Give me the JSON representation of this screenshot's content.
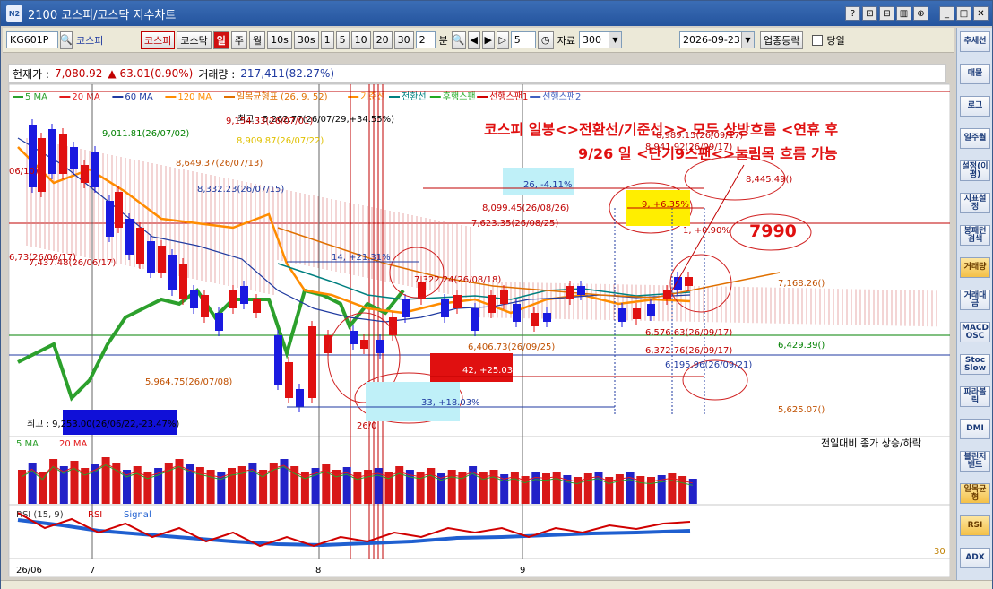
{
  "window": {
    "badge": "N2",
    "title": "2100 코스피/코스닥 지수차트",
    "buttons": [
      "?",
      "⊡",
      "⊟",
      "▥",
      "⊕",
      "_",
      "□",
      "✕"
    ]
  },
  "toolbar": {
    "code": "KG601P",
    "name": "코스피",
    "btn_kospi": "코스피",
    "btn_kosdaq": "코스닥",
    "btn_day": "일",
    "btn_week": "주",
    "btn_month": "월",
    "btn_10s": "10s",
    "btn_30s": "30s",
    "periods": [
      "1",
      "5",
      "10",
      "20",
      "30"
    ],
    "min_value": "2",
    "min_label": "분",
    "step_value": "5",
    "data_label": "자료",
    "data_value": "300",
    "date_value": "2026-09-23",
    "sector_button": "업종등락",
    "today_label": "당일"
  },
  "info": {
    "price_label": "현재가 :",
    "price": "7,080.92",
    "change": "▲ 63.01(0.90%)",
    "volume_label": "거래량 :",
    "volume": "217,411(82.27%)"
  },
  "legend": [
    {
      "text": "5 MA",
      "color": "#2ca02c"
    },
    {
      "text": "20 MA",
      "color": "#e31a1c"
    },
    {
      "text": "60 MA",
      "color": "#1f3aa0"
    },
    {
      "text": "120 MA",
      "color": "#ff8c00"
    },
    {
      "text": "일목균형표 (26, 9, 52)",
      "color": "#e07000"
    },
    {
      "text": "기준선",
      "color": "#ff8c00"
    },
    {
      "text": "전환선",
      "color": "#008080"
    },
    {
      "text": "후행스팬",
      "color": "#22aa22"
    },
    {
      "text": "선행스팬1",
      "color": "#d00000"
    },
    {
      "text": "선행스팬2",
      "color": "#4060c0"
    }
  ],
  "annotations": {
    "comment_line1": "코스피 일봉<>전환선/기준선>> 모두 상방흐름 <연휴 후",
    "comment_line2": "9/26 일 <단기9스팬<>눌림목 흐름 가능",
    "target": "7990",
    "high": "최고 : 5,262.77(26/07/29,+34.55%)",
    "low": "최고 : 9,253.00(26/06/22,-23.47%)",
    "labels": [
      {
        "text": "9,011.81(26/07/02)",
        "color": "#008000"
      },
      {
        "text": "9,154.33(26/07/01)",
        "color": "#c00000"
      },
      {
        "text": "8,909.87(26/07/22)",
        "color": "#e0c000"
      },
      {
        "text": "8,649.37(26/07/13)",
        "color": "#c05000"
      },
      {
        "text": "8,332.23(26/07/15)",
        "color": "#1f3aa0"
      },
      {
        "text": "8,099.45(26/08/26)",
        "color": "#c00000"
      },
      {
        "text": "8,989.15(26/09/17)",
        "color": "#c00000"
      },
      {
        "text": "8,941.92(26/09/17)",
        "color": "#c00000"
      },
      {
        "text": "8,445.49()",
        "color": "#c00000"
      },
      {
        "text": "7,623.35(26/08/25)",
        "color": "#c00000"
      },
      {
        "text": "7,322.24(26/08/18)",
        "color": "#c00000"
      },
      {
        "text": "7,168.26()",
        "color": "#c05000"
      },
      {
        "text": "6,576.63(26/09/17)",
        "color": "#c00000"
      },
      {
        "text": "6,406.73(26/09/25)",
        "color": "#c05000"
      },
      {
        "text": "6,372.76(26/09/17)",
        "color": "#c00000"
      },
      {
        "text": "6,429.39()",
        "color": "#008000"
      },
      {
        "text": "6,195.96(26/09/21)",
        "color": "#1f3aa0"
      },
      {
        "text": "5,964.75(26/07/08)",
        "color": "#c05000"
      },
      {
        "text": "5,625.07()",
        "color": "#c05000"
      },
      {
        "text": "6,73(26/06/17)",
        "color": "#c00000"
      },
      {
        "text": "7,437.48(26/06/17)",
        "color": "#c00000"
      },
      {
        "text": "06/10)",
        "color": "#c00000"
      },
      {
        "text": "26/0",
        "color": "#c00000"
      }
    ],
    "boxes": [
      {
        "text": "14, +21.31%",
        "color": "#1f3aa0"
      },
      {
        "text": "26, -4.11%",
        "color": "#1f3aa0"
      },
      {
        "text": "9, +6.35%",
        "color": "#c00000"
      },
      {
        "text": "1, +0.90%",
        "color": "#c00000"
      },
      {
        "text": "42, +25.03%",
        "color": "#ffffff"
      },
      {
        "text": "33, +18.03%",
        "color": "#1f3aa0"
      }
    ]
  },
  "volume_panel": {
    "legend": [
      {
        "text": "5 MA",
        "color": "#2ca02c"
      },
      {
        "text": "20 MA",
        "color": "#e31a1c"
      }
    ],
    "caption": "전일대비 종가 상승/하락"
  },
  "rsi_panel": {
    "legend": [
      {
        "text": "RSI (15, 9)",
        "color": "#333"
      },
      {
        "text": "RSI",
        "color": "#d00000"
      },
      {
        "text": "Signal",
        "color": "#1f5fd0"
      }
    ],
    "value": "30"
  },
  "xaxis": [
    "26/06",
    "7",
    "8",
    "9"
  ],
  "right_panel": [
    "추세선",
    "매물",
    "로그",
    "일주월",
    "설정(이평)",
    "지표설정",
    "봉패턴검색",
    "거래량",
    "거래대금",
    "MACD OSC",
    "Stoc Slow",
    "파라볼릭",
    "DMI",
    "볼린저밴드",
    "일목균형",
    "RSI",
    "ADX"
  ]
}
